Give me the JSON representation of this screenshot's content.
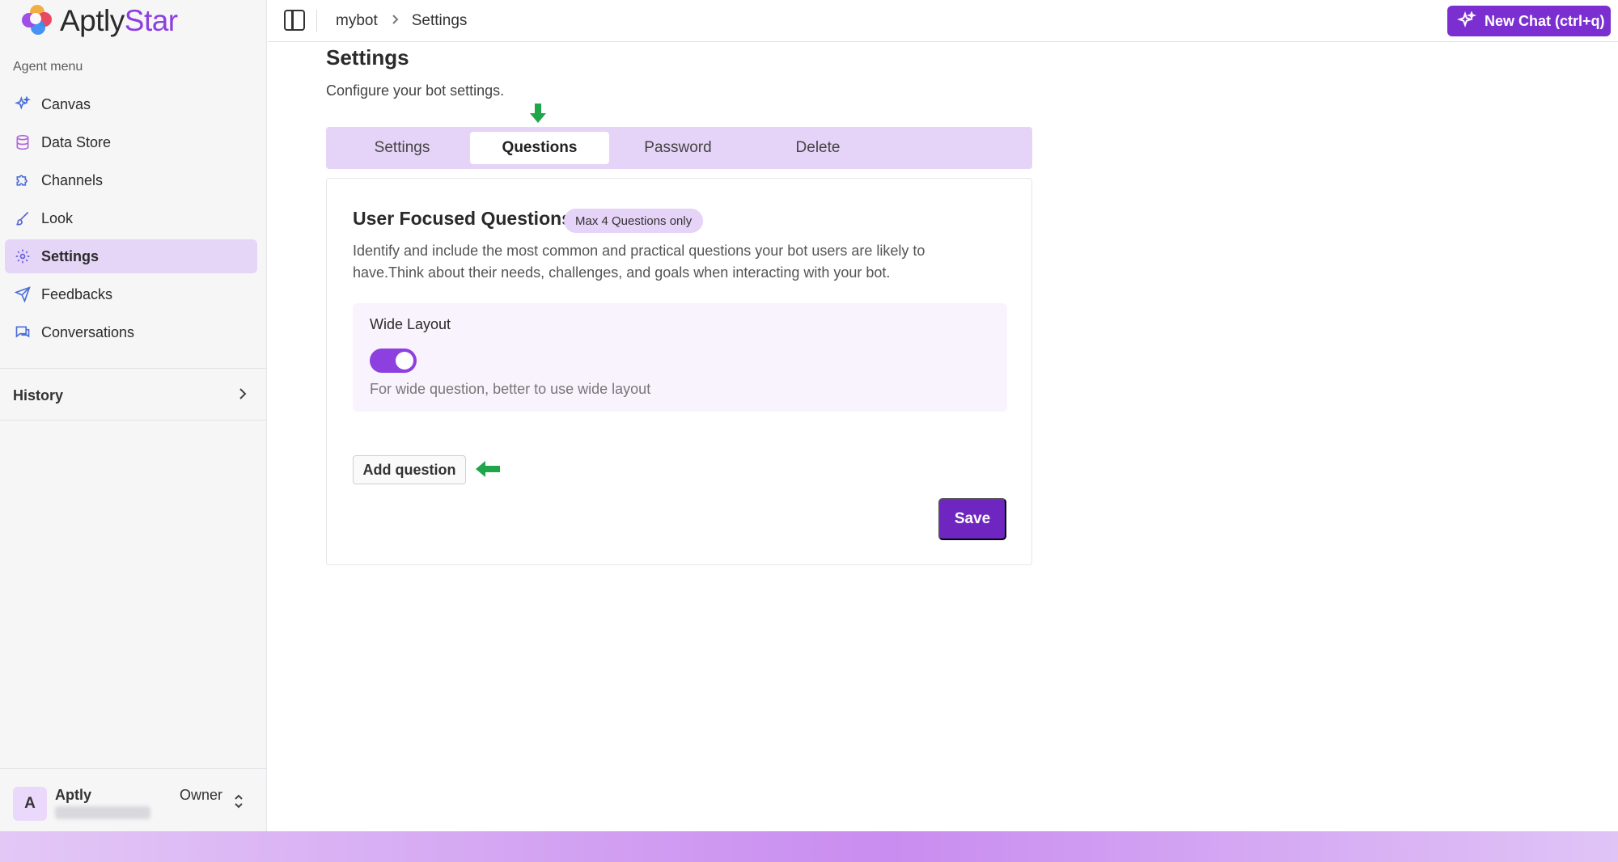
{
  "brand": {
    "name_main": "Aptly",
    "name_accent": "Star"
  },
  "sidebar": {
    "section_label": "Agent menu",
    "items": [
      {
        "label": "Canvas",
        "icon": "sparkles-icon"
      },
      {
        "label": "Data Store",
        "icon": "database-icon"
      },
      {
        "label": "Channels",
        "icon": "puzzle-icon"
      },
      {
        "label": "Look",
        "icon": "brush-icon"
      },
      {
        "label": "Settings",
        "icon": "gear-icon",
        "active": true
      },
      {
        "label": "Feedbacks",
        "icon": "send-icon"
      },
      {
        "label": "Conversations",
        "icon": "chat-icon"
      }
    ],
    "history_label": "History",
    "user": {
      "initial": "A",
      "name": "Aptly",
      "role": "Owner"
    }
  },
  "topbar": {
    "breadcrumb": [
      "mybot",
      "Settings"
    ],
    "new_chat_label": "New Chat (ctrl+q)"
  },
  "main": {
    "title": "Settings",
    "subtitle": "Configure your bot settings.",
    "tabs": [
      {
        "label": "Settings"
      },
      {
        "label": "Questions",
        "active": true
      },
      {
        "label": "Password"
      },
      {
        "label": "Delete"
      }
    ],
    "card": {
      "title": "User Focused Questions",
      "badge": "Max 4 Questions only",
      "description": "Identify and include the most common and practical questions your bot users are likely to have.Think about their needs, challenges, and goals when interacting with your bot.",
      "wide_layout": {
        "label": "Wide Layout",
        "enabled": true,
        "help": "For wide question, better to use wide layout"
      },
      "add_question_label": "Add question",
      "save_label": "Save"
    }
  },
  "colors": {
    "accent": "#7b2fd1",
    "tab_bg": "#e6d3f8",
    "annotation_arrow": "#1fa64a"
  }
}
